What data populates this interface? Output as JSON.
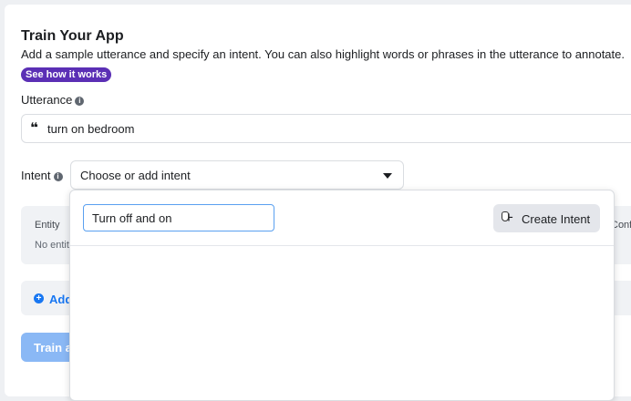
{
  "page": {
    "title": "Train Your App",
    "subtitle": "Add a sample utterance and specify an intent. You can also highlight words or phrases in the utterance to annotate.",
    "help_pill": "See how it works"
  },
  "utterance": {
    "label": "Utterance",
    "info_icon": "info-icon",
    "quote_glyph": "❝",
    "value": "turn on bedroom"
  },
  "intent": {
    "label": "Intent",
    "info_icon": "info-icon",
    "placeholder": "Choose or add intent"
  },
  "entity_table": {
    "header_entity": "Entity",
    "empty_text": "No entity",
    "header_confidence": "Conf"
  },
  "add_entity": {
    "label": "Add"
  },
  "train_button": {
    "label": "Train an"
  },
  "dropdown": {
    "search_value": "Turn off and on",
    "create_label": "Create Intent",
    "create_icon": "plus-icon"
  },
  "colors": {
    "accent": "#1877f2",
    "pill": "#5b2fb5",
    "train_disabled": "#8ab8f5"
  }
}
